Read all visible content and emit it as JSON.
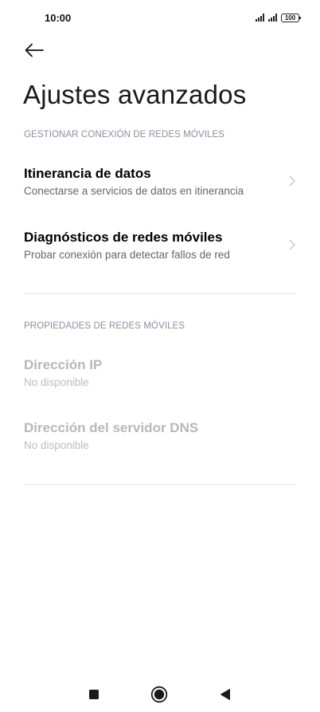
{
  "status_bar": {
    "time": "10:00",
    "battery": "100",
    "icons": [
      "signal-icon",
      "signal-icon",
      "battery-icon"
    ]
  },
  "header": {
    "back_icon": "arrow-left-icon",
    "title": "Ajustes avanzados"
  },
  "sections": [
    {
      "header": "GESTIONAR CONEXIÓN DE REDES MÓVILES",
      "items": [
        {
          "title": "Itinerancia de datos",
          "subtitle": "Conectarse a servicios de datos en itinerancia",
          "icon": "chevron-right-icon"
        },
        {
          "title": "Diagnósticos de redes móviles",
          "subtitle": "Probar conexión para detectar fallos de red",
          "icon": "chevron-right-icon"
        }
      ]
    },
    {
      "header": "PROPIEDADES DE REDES MÓVILES",
      "items": [
        {
          "title": "Dirección IP",
          "subtitle": "No disponible"
        },
        {
          "title": "Dirección del servidor DNS",
          "subtitle": "No disponible"
        }
      ]
    }
  ],
  "nav_bar": {
    "icons": [
      "recents-square-icon",
      "home-circle-icon",
      "back-triangle-icon"
    ]
  },
  "colors": {
    "section_header": "#8a8fa0",
    "disabled_text": "#b8b8b8",
    "divider": "#e6e6e6"
  }
}
